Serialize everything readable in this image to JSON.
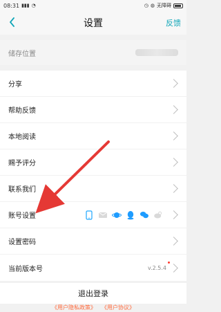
{
  "status_bar": {
    "time": "08:31",
    "battery_label": "无障碍"
  },
  "header": {
    "title": "设置",
    "right_action": "反馈"
  },
  "storage": {
    "label": "储存位置",
    "value": ""
  },
  "settings_list": [
    {
      "label": "分享"
    },
    {
      "label": "帮助反馈"
    },
    {
      "label": "本地阅读"
    },
    {
      "label": "赐予评分"
    },
    {
      "label": "联系我们"
    },
    {
      "label": "账号设置",
      "icons": [
        "phone-icon",
        "mail-icon",
        "planet-icon",
        "qq-icon",
        "wechat-icon",
        "weibo-icon"
      ]
    },
    {
      "label": "设置密码"
    },
    {
      "label": "当前版本号",
      "value": "v.2.5.4"
    }
  ],
  "logout": {
    "label": "退出登录"
  },
  "links": {
    "privacy": "《用户隐私政策》",
    "agreement": "《用户协议》"
  },
  "colors": {
    "accent": "#11a6b8",
    "link": "#ff6a3d",
    "arrow": "#e53935"
  }
}
